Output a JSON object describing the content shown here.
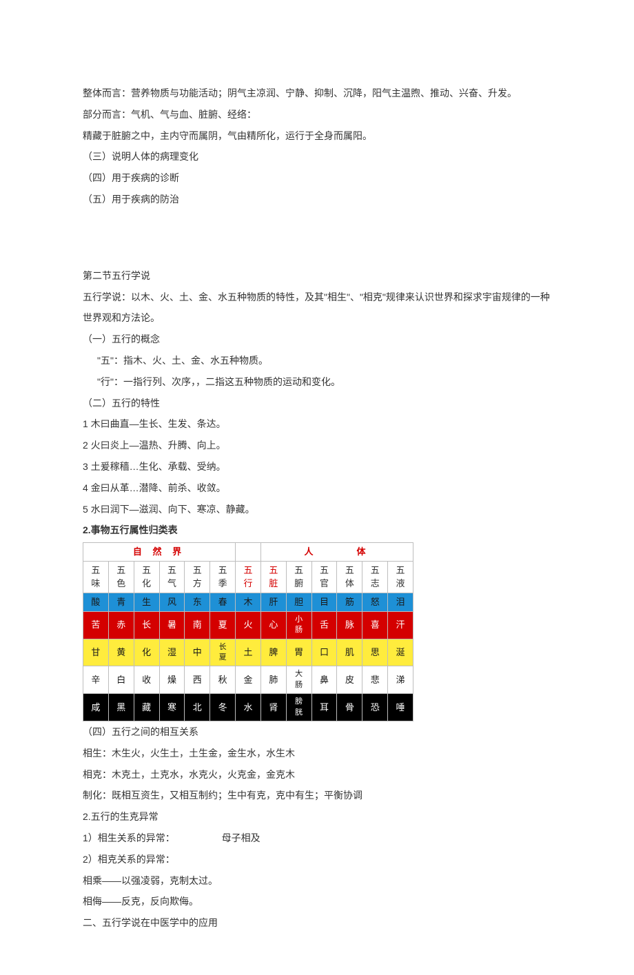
{
  "intro": {
    "p1": "整体而言：营养物质与功能活动；阴气主凉润、宁静、抑制、沉降，阳气主温煦、推动、兴奋、升发。",
    "p2": "部分而言：气机、气与血、脏腑、经络：",
    "p3": "精藏于脏腑之中，主内守而属阴，气由精所化，运行于全身而属阳。",
    "p4": "（三）说明人体的病理变化",
    "p5": "（四）用于疾病的诊断",
    "p6": "（五）用于疾病的防治"
  },
  "section2": {
    "title": "第二节五行学说",
    "def": "五行学说：以木、火、土、金、水五种物质的特性，及其\"相生\"、\"相克\"规律来认识世界和探求宇宙规律的一种世界观和方法论。",
    "sub1": "（一）五行的概念",
    "sub1a": "\"五\"：指木、火、土、金、水五种物质。",
    "sub1b": "\"行\"：一指行列、次序，，二指这五种物质的运动和变化。",
    "sub2": "（二）五行的特性",
    "c1": "1 木曰曲直—生长、生发、条达。",
    "c2": "2 火曰炎上—温热、升腾、向上。",
    "c3": "3 土爰稼穑…生化、承载、受纳。",
    "c4": "4 金曰从革…潜降、前杀、收敛。",
    "c5": "5 水曰润下—滋润、向下、寒凉、静藏。",
    "tableTitle": "2.事物五行属性归类表"
  },
  "chart_data": {
    "type": "table",
    "title": "事物五行属性归类表",
    "groups": [
      {
        "label": "自 然 界",
        "span": 6
      },
      {
        "label": "",
        "span": 1
      },
      {
        "label": "人　　　体",
        "span": 6
      }
    ],
    "headers": [
      "五味",
      "五色",
      "五化",
      "五气",
      "五方",
      "五季",
      "五行",
      "五脏",
      "五腑",
      "五官",
      "五体",
      "五志",
      "五液"
    ],
    "header_red_indices": [
      6,
      7
    ],
    "rows": [
      {
        "class": "row-wood",
        "cells": [
          "酸",
          "青",
          "生",
          "风",
          "东",
          "春",
          "木",
          "肝",
          "胆",
          "目",
          "筋",
          "怒",
          "泪"
        ]
      },
      {
        "class": "row-fire",
        "cells": [
          "苦",
          "赤",
          "长",
          "暑",
          "南",
          "夏",
          "火",
          "心",
          "小肠",
          "舌",
          "脉",
          "喜",
          "汗"
        ]
      },
      {
        "class": "row-earth",
        "cells": [
          "甘",
          "黄",
          "化",
          "湿",
          "中",
          "长夏",
          "土",
          "脾",
          "胃",
          "口",
          "肌",
          "思",
          "涎"
        ]
      },
      {
        "class": "row-metal",
        "cells": [
          "辛",
          "白",
          "收",
          "燥",
          "西",
          "秋",
          "金",
          "肺",
          "大肠",
          "鼻",
          "皮",
          "悲",
          "涕"
        ]
      },
      {
        "class": "row-water",
        "cells": [
          "咸",
          "黑",
          "藏",
          "寒",
          "北",
          "冬",
          "水",
          "肾",
          "膀胱",
          "耳",
          "骨",
          "恐",
          "唾"
        ]
      }
    ]
  },
  "after": {
    "sub4": "（四）五行之间的相互关系",
    "a1": "相生：木生火，火生土，土生金，金生水，水生木",
    "a2": "相克：木克土，土克水，水克火，火克金，金克木",
    "a3": "制化：既相互资生，又相互制约；生中有克，克中有生；平衡协调",
    "a4": "2.五行的生克异常",
    "a5a": "1）相生关系的异常：",
    "a5b": "母子相及",
    "a6": "2）相克关系的异常：",
    "a7": "相乘——以强凌弱，克制太过。",
    "a8": "相侮——反克，反向欺侮。",
    "a9": "二、五行学说在中医学中的应用"
  }
}
